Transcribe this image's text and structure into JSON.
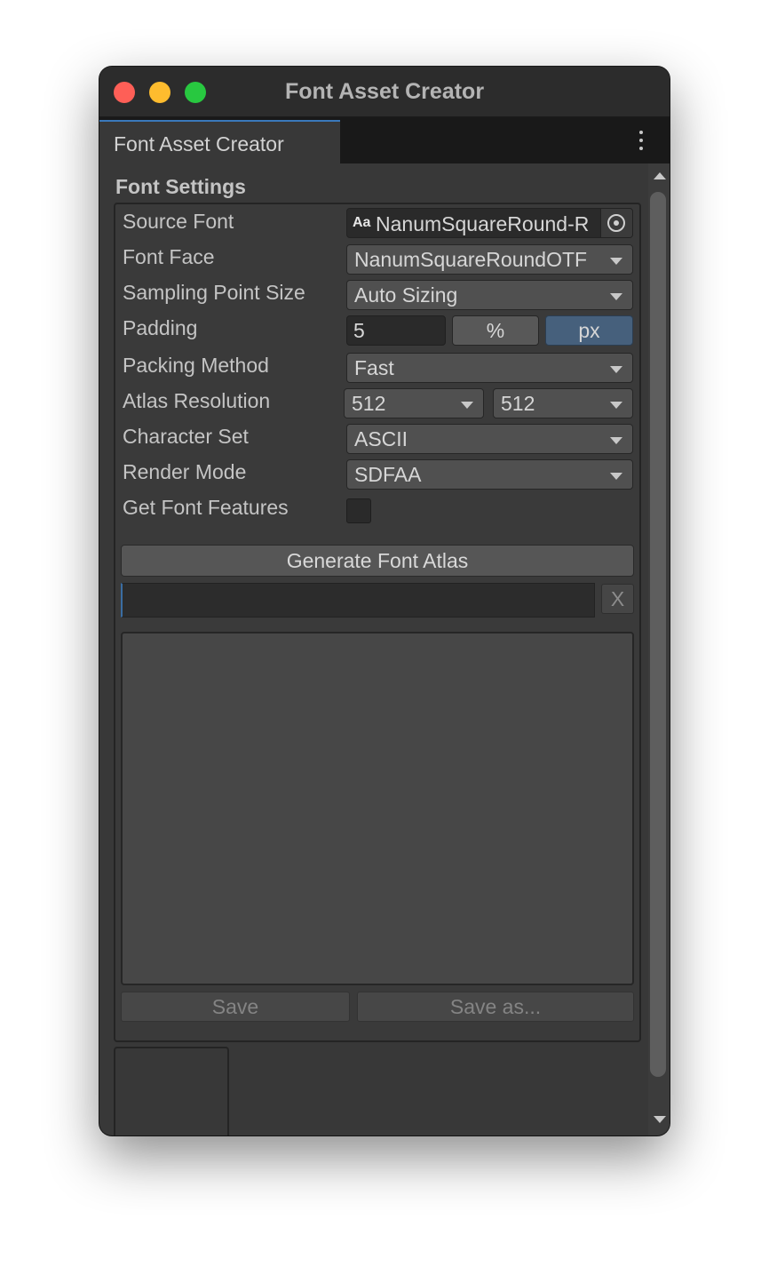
{
  "window": {
    "title": "Font Asset Creator"
  },
  "tab": {
    "label": "Font Asset Creator",
    "menu_icon": "kebab-menu-icon"
  },
  "font_settings": {
    "section_title": "Font Settings",
    "source_font": {
      "label": "Source Font",
      "icon_text": "Aa",
      "value": "NanumSquareRound-R"
    },
    "font_face": {
      "label": "Font Face",
      "value": "NanumSquareRoundOTF"
    },
    "sampling_point_size": {
      "label": "Sampling Point Size",
      "value": "Auto Sizing"
    },
    "padding": {
      "label": "Padding",
      "value": "5",
      "unit_percent": "%",
      "unit_px": "px",
      "selected_unit": "px"
    },
    "packing_method": {
      "label": "Packing Method",
      "value": "Fast"
    },
    "atlas_resolution": {
      "label": "Atlas Resolution",
      "width": "512",
      "height": "512"
    },
    "character_set": {
      "label": "Character Set",
      "value": "ASCII"
    },
    "render_mode": {
      "label": "Render Mode",
      "value": "SDFAA"
    },
    "get_font_features": {
      "label": "Get Font Features",
      "checked": false
    }
  },
  "actions": {
    "generate_label": "Generate Font Atlas",
    "clear_label": "X",
    "save_label": "Save",
    "save_as_label": "Save as..."
  },
  "colors": {
    "accent": "#3a79bb",
    "selected_unit_bg": "#46607c",
    "close": "#fe5f57",
    "minimize": "#febc2e",
    "maximize": "#28c840"
  }
}
